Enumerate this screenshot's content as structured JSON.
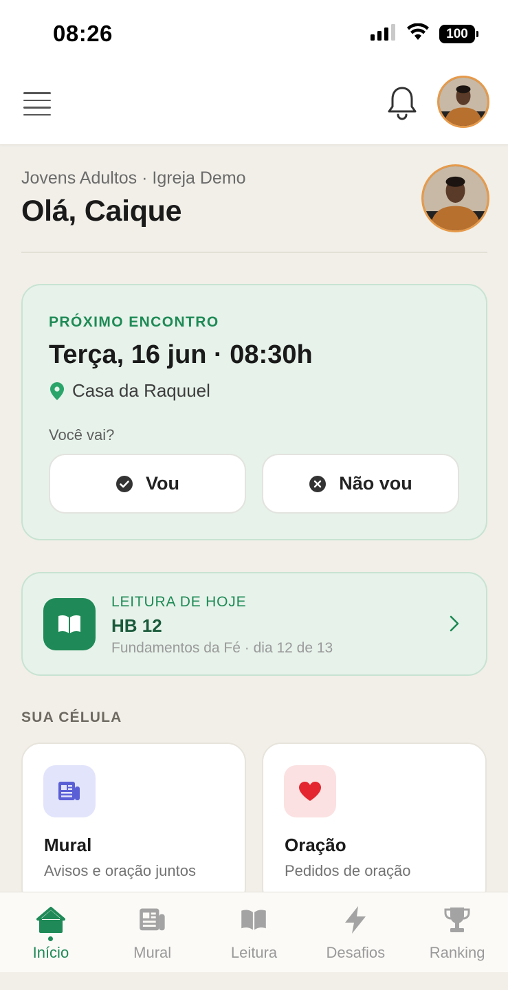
{
  "status_bar": {
    "time": "08:26",
    "battery": "100"
  },
  "app_bar": {
    "menu_icon": "menu-icon",
    "bell_icon": "bell-icon"
  },
  "greeting": {
    "subtitle": "Jovens Adultos · Igreja Demo",
    "title": "Olá, Caique"
  },
  "meeting": {
    "label": "PRÓXIMO ENCONTRO",
    "date": "Terça, 16 jun · 08:30h",
    "location": "Casa da Raquuel",
    "question": "Você vai?",
    "yes_label": "Vou",
    "no_label": "Não vou"
  },
  "reading": {
    "label": "LEITURA DE HOJE",
    "title": "HB 12",
    "subtitle": "Fundamentos da Fé · dia 12 de 13"
  },
  "cell": {
    "section_title": "SUA CÉLULA",
    "cards": [
      {
        "title": "Mural",
        "subtitle": "Avisos e oração juntos",
        "icon": "newspaper-icon"
      },
      {
        "title": "Oração",
        "subtitle": "Pedidos de oração",
        "icon": "heart-icon"
      }
    ]
  },
  "bottom_nav": {
    "items": [
      {
        "label": "Início",
        "icon": "home-icon",
        "active": true
      },
      {
        "label": "Mural",
        "icon": "newspaper-icon",
        "active": false
      },
      {
        "label": "Leitura",
        "icon": "book-icon",
        "active": false
      },
      {
        "label": "Desafios",
        "icon": "lightning-icon",
        "active": false
      },
      {
        "label": "Ranking",
        "icon": "trophy-icon",
        "active": false
      }
    ]
  },
  "colors": {
    "accent_green": "#1f8a57",
    "card_green_bg": "#e6f2ea",
    "avatar_ring": "#e69a4a",
    "page_bg": "#f1efe8"
  }
}
